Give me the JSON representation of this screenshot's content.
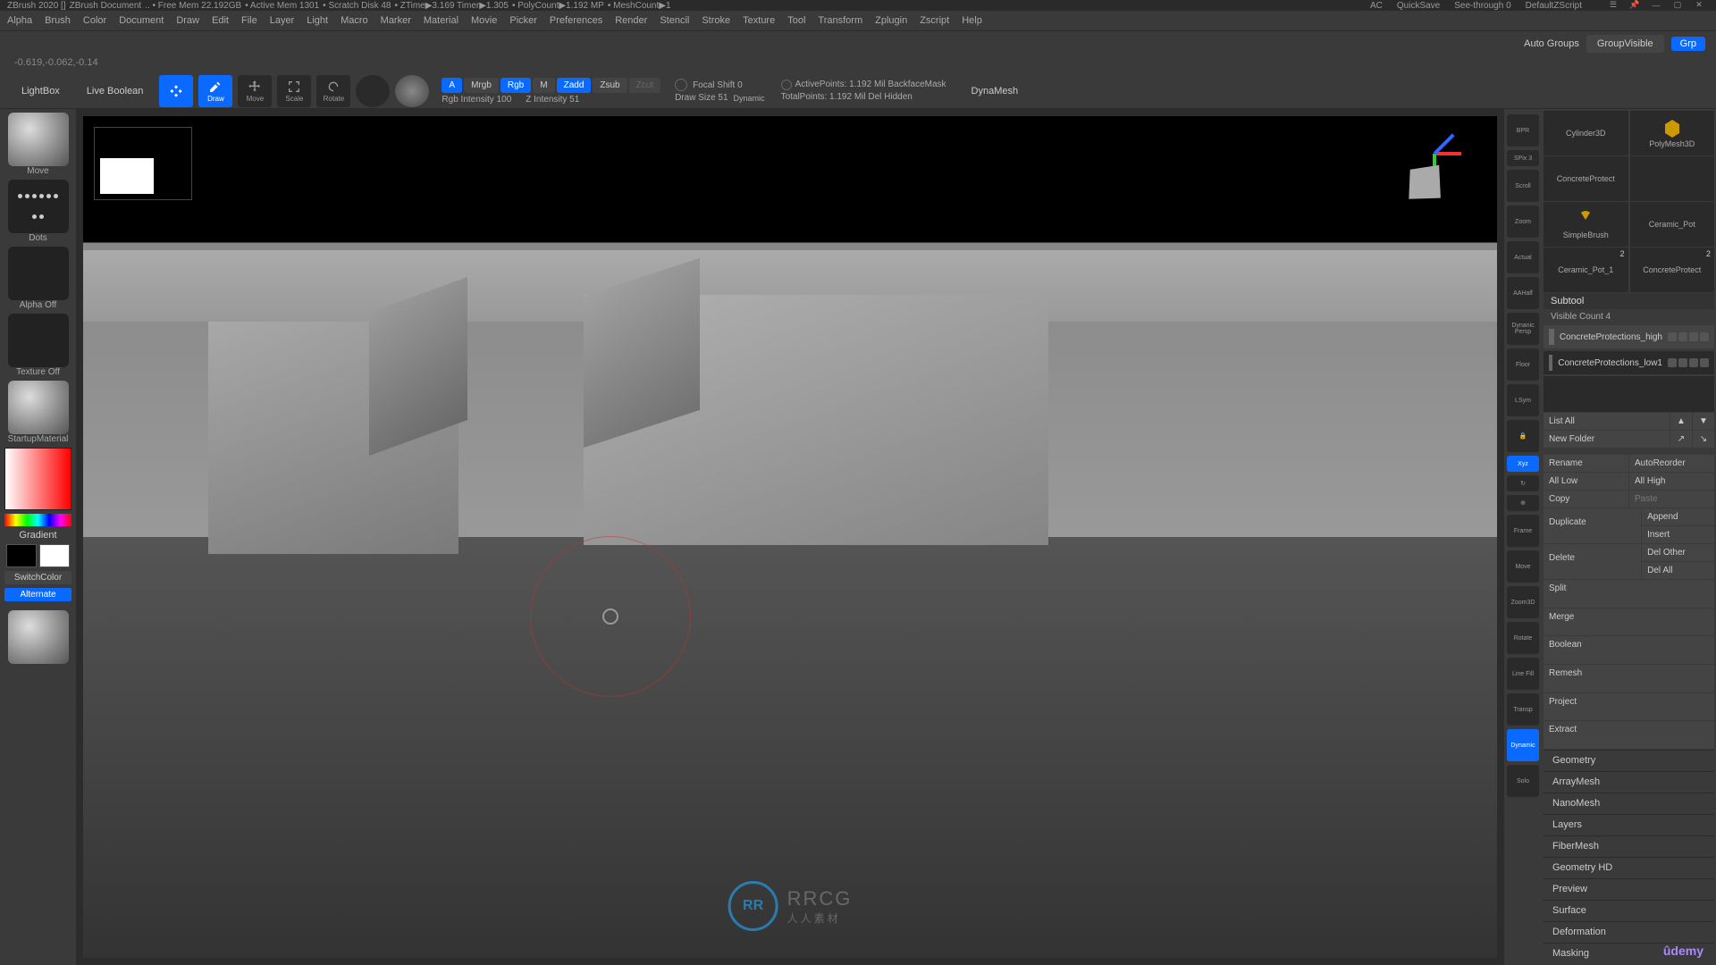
{
  "titlebar": {
    "app": "ZBrush 2020 []",
    "doc": "ZBrush Document",
    "freemem": ".. • Free Mem 22.192GB",
    "activemem": "• Active Mem 1301",
    "scratch": "• Scratch Disk 48",
    "ztime": "• ZTime▶3.169 Timer▶1.305",
    "polycount": "• PolyCount▶1.192 MP",
    "meshcount": "• MeshCount▶1",
    "ac": "AC",
    "quicksave": "QuickSave",
    "seethrough": "See-through  0",
    "zscript": "DefaultZScript"
  },
  "menu": [
    "Alpha",
    "Brush",
    "Color",
    "Document",
    "Draw",
    "Edit",
    "File",
    "Layer",
    "Light",
    "Macro",
    "Marker",
    "Material",
    "Movie",
    "Picker",
    "Preferences",
    "Render",
    "Stencil",
    "Stroke",
    "Texture",
    "Tool",
    "Transform",
    "Zplugin",
    "Zscript",
    "Help"
  ],
  "topbar": {
    "autogroups": "Auto Groups",
    "groupvisible": "GroupVisible",
    "grp": "Grp"
  },
  "coord": "-0.619,-0.062,-0.14",
  "toolbar": {
    "lightbox": "LightBox",
    "liveboolean": "Live Boolean",
    "gizmo": "",
    "draw": "Draw",
    "move": "Move",
    "scale": "Scale",
    "rotate": "Rotate",
    "a": "A",
    "mrgb": "Mrgb",
    "rgb": "Rgb",
    "m": "M",
    "zadd": "Zadd",
    "zsub": "Zsub",
    "zcut": "Zcut",
    "rgbintensity": "Rgb Intensity 100",
    "zintensity": "Z Intensity 51",
    "focalshift": "Focal Shift 0",
    "drawsize": "Draw Size 51",
    "dynamic": "Dynamic",
    "activepoints": "ActivePoints: 1.192 Mil BackfaceMask",
    "totalpoints": "TotalPoints: 1.192 Mil   Del Hidden",
    "dynamesh": "DynaMesh"
  },
  "left": {
    "move": "Move",
    "dots": "Dots",
    "alphaoff": "Alpha Off",
    "textureoff": "Texture Off",
    "startupmat": "StartupMaterial",
    "gradient": "Gradient",
    "switchcolor": "SwitchColor",
    "alternate": "Alternate"
  },
  "rightstrip": [
    "BPR",
    "SPix 3",
    "Scroll",
    "Zoom",
    "Actual",
    "AAHalf",
    "Dynanic Persp",
    "Floor",
    "LSym",
    "",
    "Xyz",
    "",
    "",
    "Frame",
    "Move",
    "Zoom3D",
    "Rotate",
    "Line Fill",
    "Transp",
    "Dynamic",
    "Solo"
  ],
  "tools": {
    "row1": [
      "Cylinder3D",
      "PolyMesh3D"
    ],
    "row2": [
      "ConcreteProtect",
      ""
    ],
    "row3": [
      "SimpleBrush",
      "Ceramic_Pot"
    ],
    "row4": [
      "Ceramic_Pot_1",
      "ConcreteProtect"
    ],
    "badge2": "2",
    "badge2b": "2"
  },
  "subtool": {
    "header": "Subtool",
    "visiblecount": "Visible Count 4",
    "items": [
      "ConcreteProtections_high",
      "ConcreteProtections_low1"
    ]
  },
  "actions": {
    "listall": "List All",
    "newfolder": "New Folder",
    "rename": "Rename",
    "autoreorder": "AutoReorder",
    "alllow": "All Low",
    "allhigh": "All High",
    "copy": "Copy",
    "paste": "Paste",
    "duplicate": "Duplicate",
    "append": "Append",
    "insert": "Insert",
    "delete": "Delete",
    "delother": "Del Other",
    "delall": "Del All",
    "split": "Split",
    "merge": "Merge",
    "boolean": "Boolean",
    "remesh": "Remesh",
    "project": "Project",
    "extract": "Extract"
  },
  "accordions": [
    "Geometry",
    "ArrayMesh",
    "NanoMesh",
    "Layers",
    "FiberMesh",
    "Geometry HD",
    "Preview",
    "Surface",
    "Deformation",
    "Masking"
  ],
  "watermark": {
    "logo": "RR",
    "text": "RRCG",
    "sub": "人人素材"
  },
  "udemy": "ûdemy"
}
